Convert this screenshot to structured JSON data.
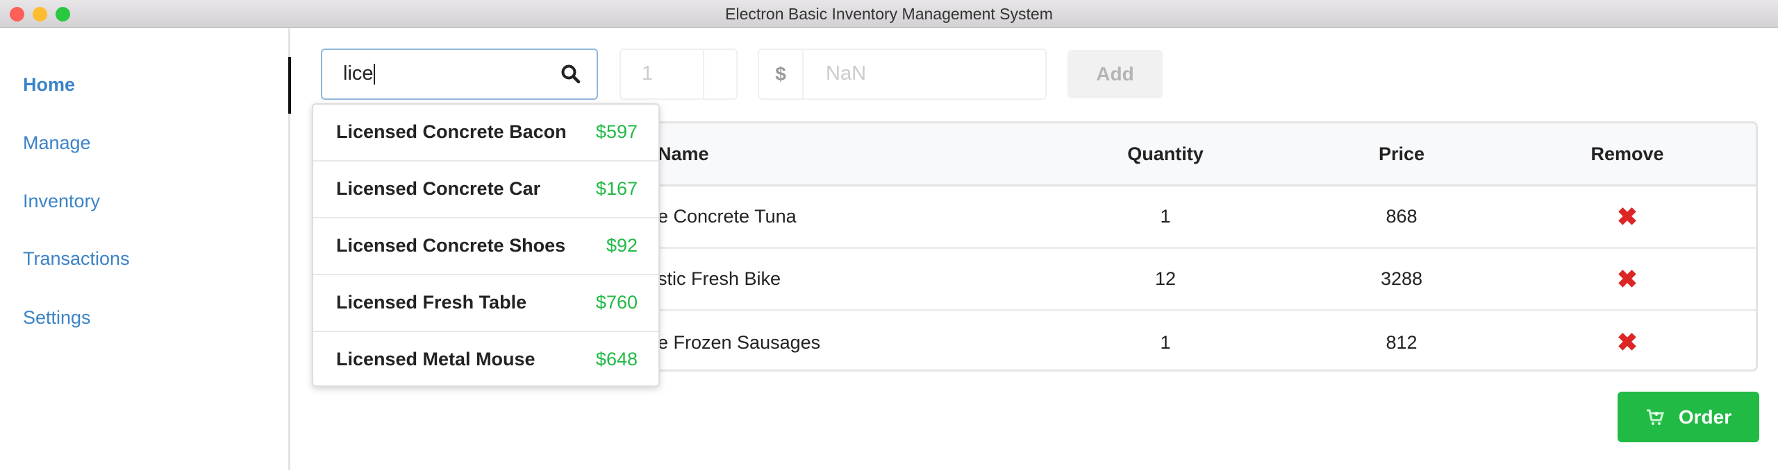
{
  "window": {
    "title": "Electron Basic Inventory Management System"
  },
  "sidebar": {
    "items": [
      {
        "label": "Home",
        "active": true
      },
      {
        "label": "Manage"
      },
      {
        "label": "Inventory"
      },
      {
        "label": "Transactions"
      },
      {
        "label": "Settings"
      }
    ]
  },
  "toolbar": {
    "search_value": "lice",
    "quantity_placeholder": "1",
    "currency_symbol": "$",
    "price_placeholder": "NaN",
    "add_label": "Add",
    "search_icon": "search-icon"
  },
  "suggestions": [
    {
      "name": "Licensed Concrete Bacon",
      "price": "$597"
    },
    {
      "name": "Licensed Concrete Car",
      "price": "$167"
    },
    {
      "name": "Licensed Concrete Shoes",
      "price": "$92"
    },
    {
      "name": "Licensed Fresh Table",
      "price": "$760"
    },
    {
      "name": "Licensed Metal Mouse",
      "price": "$648"
    }
  ],
  "table": {
    "headers": {
      "name": "Name",
      "quantity": "Quantity",
      "price": "Price",
      "remove": "Remove"
    },
    "rows": [
      {
        "name": "e Concrete Tuna",
        "quantity": "1",
        "price": "868"
      },
      {
        "name": "stic Fresh Bike",
        "quantity": "12",
        "price": "3288"
      },
      {
        "name": "e Frozen Sausages",
        "quantity": "1",
        "price": "812"
      }
    ]
  },
  "order": {
    "label": "Order",
    "icon": "cart-plus-icon"
  },
  "colors": {
    "accent": "#3b83c8",
    "success": "#21ba45",
    "danger": "#dc2626"
  }
}
